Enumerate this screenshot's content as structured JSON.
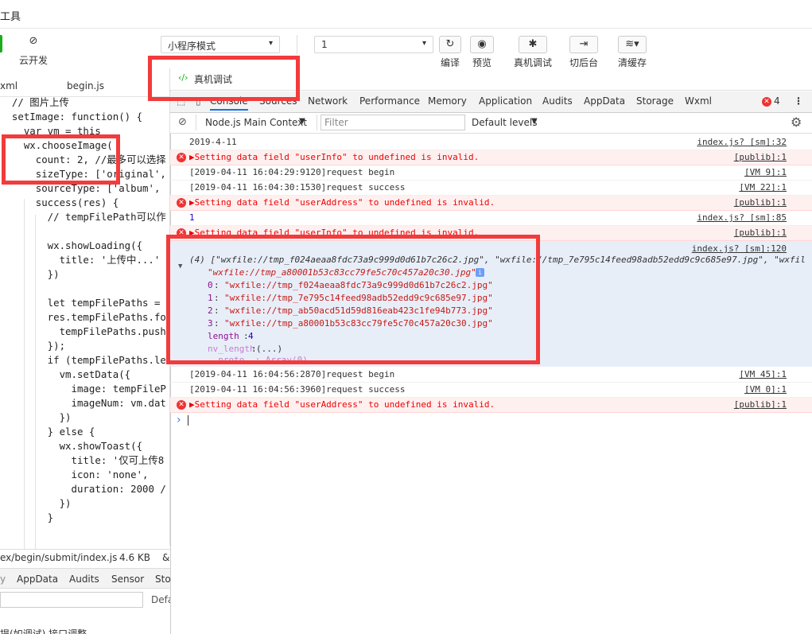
{
  "app": {
    "title": "开发者工具",
    "title_visible": "工具"
  },
  "toolbar": {
    "cloud_label": "云开发",
    "mode_select": "小程序模式",
    "compile_select": "1",
    "compile_label": "编译",
    "preview_label": "预览",
    "remote_debug_label": "真机调试",
    "background_label": "切后台",
    "clear_cache_label": "清缓存"
  },
  "editor": {
    "tab_left": "xml",
    "tab_active": "begin.js",
    "lines": [
      "  // 图片上传",
      "  setImage: function() {",
      "    var vm = this",
      "    wx.chooseImage(",
      "      count: 2, //最多可以选择",
      "      sizeType: ['original',",
      "      sourceType: ['album',",
      "      success(res) {",
      "        // tempFilePath可以作",
      "",
      "        wx.showLoading({",
      "          title: '上传中...'",
      "        })",
      "",
      "        let tempFilePaths =",
      "        res.tempFilePaths.fo",
      "          tempFilePaths.push",
      "        });",
      "        if (tempFilePaths.le",
      "          vm.setData({",
      "            image: tempFileP",
      "            imageNum: vm.dat",
      "          })",
      "        } else {",
      "          wx.showToast({",
      "            title: '仅可上传8",
      "            icon: 'none',",
      "            duration: 2000 /",
      "          })",
      "        }"
    ],
    "status_path": "ex/begin/submit/index.js",
    "status_size": "4.6 KB",
    "bottom_tabs": [
      "AppData",
      "Audits",
      "Sensor",
      "Sto"
    ],
    "bottom_default": "Defa",
    "bottom_partial": "提(如调试) 接口调整"
  },
  "panel": {
    "title": "真机调试",
    "tabs": [
      "Console",
      "Sources",
      "Network",
      "Performance",
      "Memory",
      "Application",
      "Audits",
      "AppData",
      "Storage",
      "Wxml"
    ],
    "error_count": "4",
    "context": "Node.js Main Context",
    "filter_placeholder": "Filter",
    "levels": "Default levels"
  },
  "console": [
    {
      "text": "2019-4-11",
      "src": "index.js? [sm]:32",
      "err": false
    },
    {
      "text": "▶Setting data field \"userInfo\" to undefined is invalid.",
      "src": "[publib]:1",
      "err": true
    },
    {
      "text": "[2019-04-11 16:04:29:9120]request begin",
      "src": "[VM 9]:1",
      "err": false
    },
    {
      "text": "[2019-04-11 16:04:30:1530]request success",
      "src": "[VM 22]:1",
      "err": false
    },
    {
      "text": "▶Setting data field \"userAddress\" to undefined is invalid.",
      "src": "[publib]:1",
      "err": true
    },
    {
      "text": "1",
      "src": "index.js? [sm]:85",
      "err": false
    },
    {
      "text": "▶Setting data field \"userInfo\" to undefined is invalid.",
      "src": "[publib]:1",
      "err": true
    }
  ],
  "object": {
    "src": "index.js? [sm]:120",
    "head": "(4) [\"wxfile://tmp_f024aeaa8fdc73a9c999d0d61b7c26c2.jpg\", \"wxfile://tmp_7e795c14feed98adb52edd9c9c685e97.jpg\", \"wxfil",
    "head2": "\"wxfile://tmp_a80001b53c83cc79fe5c70c457a20c30.jpg\"]",
    "items": [
      {
        "k": "0",
        "v": "\"wxfile://tmp_f024aeaa8fdc73a9c999d0d61b7c26c2.jpg\""
      },
      {
        "k": "1",
        "v": "\"wxfile://tmp_7e795c14feed98adb52edd9c9c685e97.jpg\""
      },
      {
        "k": "2",
        "v": "\"wxfile://tmp_ab50acd51d59d816eab423c1fe94b773.jpg\""
      },
      {
        "k": "3",
        "v": "\"wxfile://tmp_a80001b53c83cc79fe5c70c457a20c30.jpg\""
      }
    ],
    "length_key": "length",
    "length_val": "4",
    "nv_key": "nv_length",
    "nv_val": "(...)",
    "proto": "__proto__: Array(0)"
  },
  "console2": [
    {
      "text": "[2019-04-11 16:04:56:2870]request begin",
      "src": "[VM 45]:1",
      "err": false
    },
    {
      "text": "[2019-04-11 16:04:56:3960]request success",
      "src": "[VM 0]:1",
      "err": false
    },
    {
      "text": "▶Setting data field \"userAddress\" to undefined is invalid.",
      "src": "[publib]:1",
      "err": true
    }
  ],
  "prompt": "›",
  "colors": {
    "highlight": "#f23b3b",
    "error_bg": "#fff0f0",
    "object_bg": "#e8eef8",
    "accent": "#1aad19"
  }
}
